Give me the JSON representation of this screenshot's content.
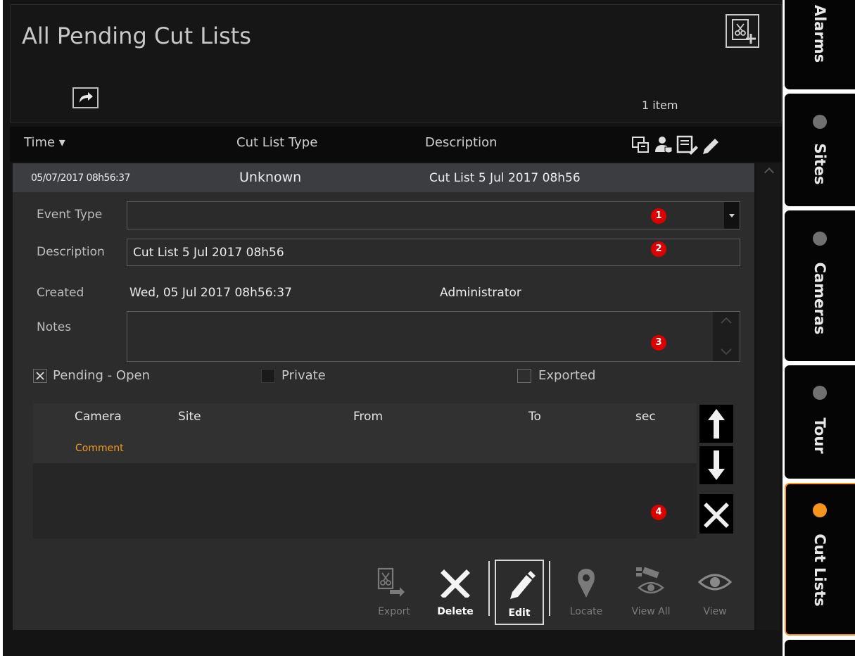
{
  "header": {
    "title": "All Pending Cut Lists",
    "item_count": "1 item"
  },
  "columns": [
    "Time ▾",
    "Cut List Type",
    "Description"
  ],
  "row": {
    "time": "05/07/2017 08h56:37",
    "type": "Unknown",
    "description": "Cut List 5 Jul 2017 08h56"
  },
  "details": {
    "event_type_label": "Event Type",
    "event_type_value": "",
    "description_label": "Description",
    "description_value": "Cut List 5 Jul 2017 08h56",
    "created_label": "Created",
    "created_value": "Wed, 05 Jul 2017  08h56:37",
    "created_by": "Administrator",
    "notes_label": "Notes",
    "notes_value": ""
  },
  "checkboxes": [
    {
      "label": "Pending - Open",
      "checked": true
    },
    {
      "label": "Private",
      "checked": false
    },
    {
      "label": "Exported",
      "checked": false
    }
  ],
  "camera_table": {
    "headers": [
      "Camera",
      "Site",
      "From",
      "To",
      "sec"
    ],
    "comment_label": "Comment"
  },
  "badges": [
    "1",
    "2",
    "3",
    "4"
  ],
  "toolbar": {
    "export": "Export",
    "delete": "Delete",
    "edit": "Edit",
    "locate": "Locate",
    "view_all": "View All",
    "view": "View"
  },
  "sidebar": [
    {
      "label": "Alarms",
      "status_color": ""
    },
    {
      "label": "Sites",
      "status_color": "#707070"
    },
    {
      "label": "Cameras",
      "status_color": "#707070"
    },
    {
      "label": "Tour",
      "status_color": "#707070"
    },
    {
      "label": "Cut Lists",
      "status_color": "#f7941d",
      "active": true
    }
  ],
  "colors": {
    "accent": "#f7941d",
    "badge": "#dd0000",
    "comment": "#f29a22"
  }
}
